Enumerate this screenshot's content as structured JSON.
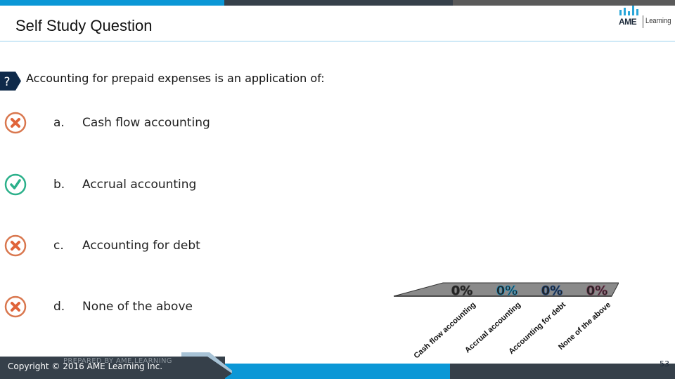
{
  "header": {
    "title": "Self Study Question",
    "logo": {
      "brand": "AME",
      "suffix": "Learning"
    }
  },
  "colors": {
    "accent_blue": "#0b97d6",
    "dark_slate": "#36404a",
    "gray": "#5a5a5a",
    "wrong": "#e0643a",
    "correct": "#2bb08a",
    "badge": "#0f2a4a"
  },
  "question": {
    "badge": "?",
    "text": "Accounting for prepaid expenses is an application of:"
  },
  "options": [
    {
      "letter": "a.",
      "text": "Cash flow accounting",
      "status": "incorrect",
      "icon": "x-circle-icon"
    },
    {
      "letter": "b.",
      "text": "Accrual accounting",
      "status": "correct",
      "icon": "check-circle-icon"
    },
    {
      "letter": "c.",
      "text": "Accounting for debt",
      "status": "incorrect",
      "icon": "x-circle-icon"
    },
    {
      "letter": "d.",
      "text": "None of the above",
      "status": "incorrect",
      "icon": "x-circle-icon"
    }
  ],
  "chart_data": {
    "type": "bar",
    "title": "",
    "xlabel": "",
    "ylabel": "",
    "categories": [
      "Cash flow accounting",
      "Accrual accounting",
      "Accounting for debt",
      "None of the above"
    ],
    "values": [
      0,
      0,
      0,
      0
    ],
    "data_labels": [
      "0%",
      "0%",
      "0%",
      "0%"
    ],
    "series_colors": [
      "#3a3a3a",
      "#1a8fc0",
      "#1f4e8c",
      "#7a3a55"
    ],
    "ylim": [
      0,
      100
    ],
    "grid": false,
    "legend": "none"
  },
  "footer": {
    "prepared_by": "PREPARED BY AME LEARNING",
    "copyright": "Copyright © 2016 AME Learning Inc.",
    "page_number": "53"
  }
}
